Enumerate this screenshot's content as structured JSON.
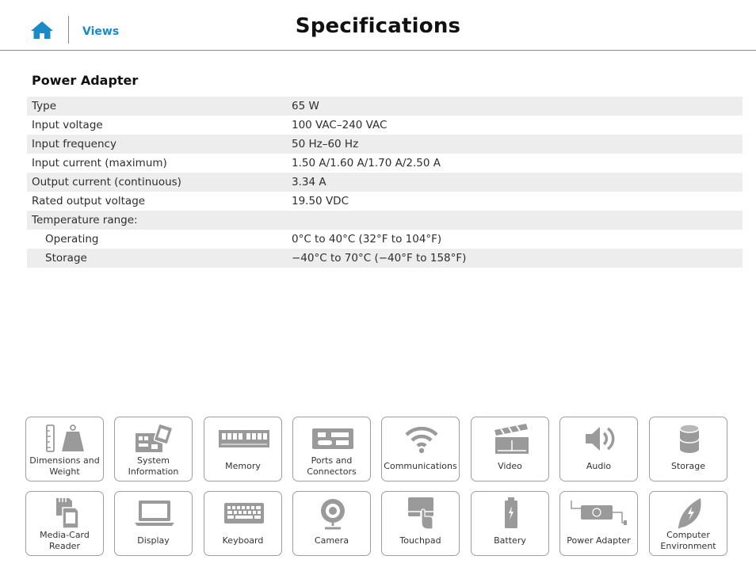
{
  "header": {
    "title": "Specifications",
    "home_icon": "home-icon",
    "views_link": "Views"
  },
  "section": {
    "title": "Power Adapter"
  },
  "specs": [
    {
      "label": "Type",
      "value": "65 W"
    },
    {
      "label": "Input voltage",
      "value": "100 VAC–240 VAC"
    },
    {
      "label": "Input frequency",
      "value": "50 Hz–60 Hz"
    },
    {
      "label": "Input current (maximum)",
      "value": "1.50 A/1.60 A/1.70 A/2.50 A"
    },
    {
      "label": "Output current (continuous)",
      "value": "3.34 A"
    },
    {
      "label": "Rated output voltage",
      "value": "19.50 VDC"
    },
    {
      "label": "Temperature range:",
      "value": ""
    },
    {
      "label": "Operating",
      "value": "0°C to 40°C (32°F to 104°F)"
    },
    {
      "label": "Storage",
      "value": "−40°C to 70°C (−40°F to 158°F)"
    }
  ],
  "tiles": [
    {
      "label": "Dimensions and Weight",
      "icon": "dimensions-weight-icon"
    },
    {
      "label": "System Information",
      "icon": "system-information-icon"
    },
    {
      "label": "Memory",
      "icon": "memory-icon"
    },
    {
      "label": "Ports and Connectors",
      "icon": "ports-connectors-icon"
    },
    {
      "label": "Communications",
      "icon": "wifi-icon"
    },
    {
      "label": "Video",
      "icon": "clapperboard-icon"
    },
    {
      "label": "Audio",
      "icon": "speaker-icon"
    },
    {
      "label": "Storage",
      "icon": "storage-cylinder-icon"
    },
    {
      "label": "Media-Card Reader",
      "icon": "media-card-icon"
    },
    {
      "label": "Display",
      "icon": "laptop-display-icon"
    },
    {
      "label": "Keyboard",
      "icon": "keyboard-icon"
    },
    {
      "label": "Camera",
      "icon": "webcam-icon"
    },
    {
      "label": "Touchpad",
      "icon": "touchpad-icon"
    },
    {
      "label": "Battery",
      "icon": "battery-icon"
    },
    {
      "label": "Power Adapter",
      "icon": "power-adapter-icon"
    },
    {
      "label": "Computer Environment",
      "icon": "leaf-icon"
    }
  ],
  "colors": {
    "accent": "#1a8bc4",
    "icon_gray": "#9a9a9a",
    "row_stripe": "#ededed",
    "tile_border": "#9e9e9e"
  }
}
